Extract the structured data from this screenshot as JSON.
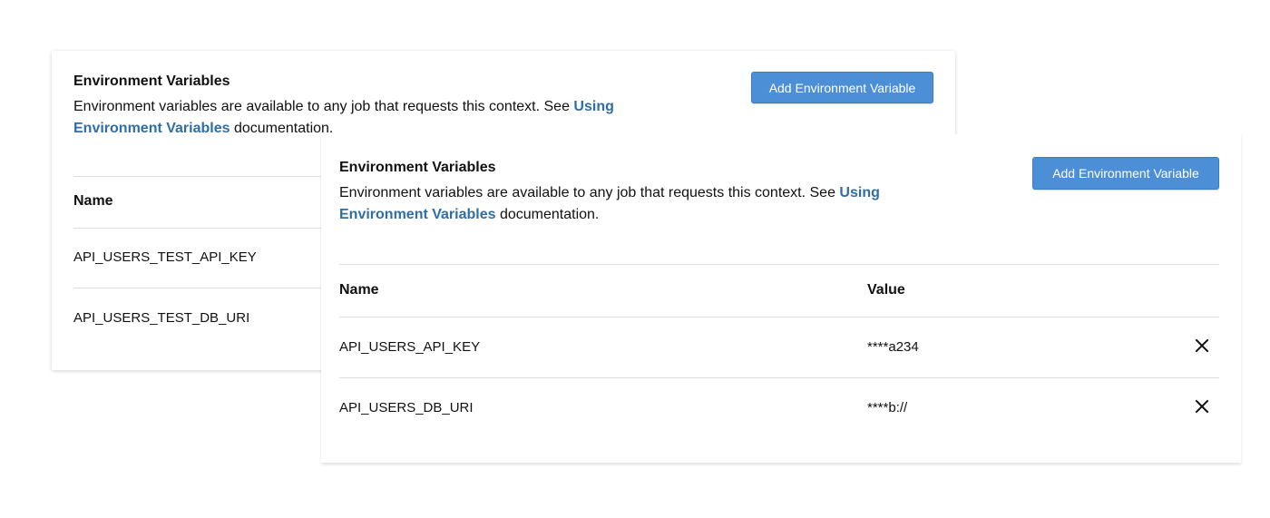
{
  "back_panel": {
    "title": "Environment Variables",
    "description_prefix": "Environment variables are available to any job that requests this context. See ",
    "link_text_1": "Using",
    "link_text_2": "Environment Variables",
    "description_suffix": " documentation.",
    "add_button_label": "Add Environment Variable",
    "columns": {
      "name": "Name"
    },
    "rows": [
      {
        "name": "API_USERS_TEST_API_KEY"
      },
      {
        "name": "API_USERS_TEST_DB_URI"
      }
    ]
  },
  "front_panel": {
    "title": "Environment Variables",
    "description_prefix": "Environment variables are available to any job that requests this context. See ",
    "link_text_1": "Using",
    "link_text_2": "Environment Variables",
    "description_suffix": " documentation.",
    "add_button_label": "Add Environment Variable",
    "columns": {
      "name": "Name",
      "value": "Value"
    },
    "rows": [
      {
        "name": "API_USERS_API_KEY",
        "value": "****a234",
        "delete_icon": "close-icon"
      },
      {
        "name": "API_USERS_DB_URI",
        "value": "****b://",
        "delete_icon": "close-icon"
      }
    ]
  },
  "colors": {
    "button_bg": "#4d8fd6",
    "link": "#2f6ea5",
    "text": "#111111",
    "divider": "#dedede"
  }
}
